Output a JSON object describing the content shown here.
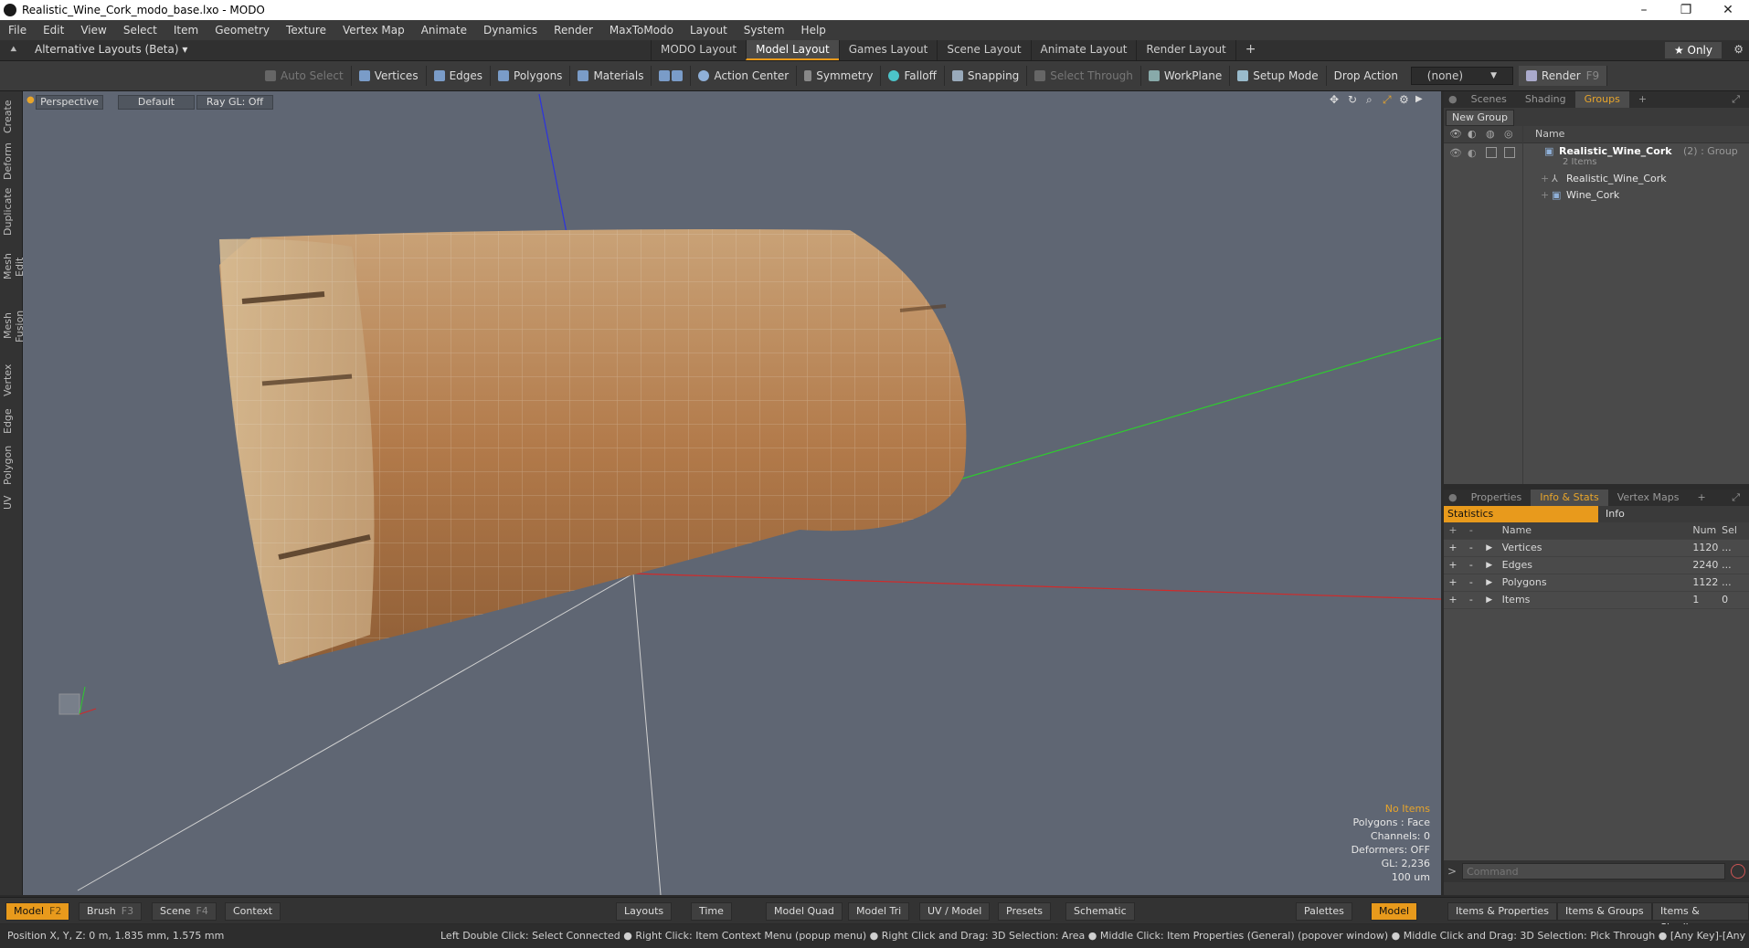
{
  "window": {
    "title": "Realistic_Wine_Cork_modo_base.lxo - MODO",
    "minimize": "–",
    "maximize": "❐",
    "close": "✕"
  },
  "menu": [
    "File",
    "Edit",
    "View",
    "Select",
    "Item",
    "Geometry",
    "Texture",
    "Vertex Map",
    "Animate",
    "Dynamics",
    "Render",
    "MaxToModo",
    "Layout",
    "System",
    "Help"
  ],
  "layoutbar": {
    "alt_layouts": "Alternative Layouts (Beta) ▾",
    "tabs": [
      "MODO Layout",
      "Model Layout",
      "Games Layout",
      "Scene Layout",
      "Animate Layout",
      "Render Layout"
    ],
    "add": "+",
    "only": "★ Only"
  },
  "toolbar": {
    "auto_select": "Auto Select",
    "vertices": "Vertices",
    "edges": "Edges",
    "polygons": "Polygons",
    "materials": "Materials",
    "action_center": "Action Center",
    "symmetry": "Symmetry",
    "falloff": "Falloff",
    "snapping": "Snapping",
    "select_through": "Select Through",
    "workplane": "WorkPlane",
    "setup_mode": "Setup Mode",
    "drop_action": "Drop Action",
    "drop_value": "(none)",
    "render": "Render",
    "render_key": "F9"
  },
  "lefttabs": [
    "Create",
    "Deform",
    "Duplicate",
    "Mesh Edit",
    "Mesh Fusion",
    "Vertex",
    "Edge",
    "Polygon",
    "UV"
  ],
  "viewport": {
    "view": "Perspective",
    "shading": "Default",
    "raygl": "Ray GL: Off",
    "stats": {
      "items": "No Items",
      "polygons": "Polygons : Face",
      "channels": "Channels: 0",
      "deformers": "Deformers: OFF",
      "gl": "GL: 2,236",
      "scale": "100 um"
    }
  },
  "scene_panel": {
    "tabs": [
      "Scenes",
      "Shading",
      "Groups"
    ],
    "new_group": "New Group",
    "col_name": "Name",
    "group_name": "Realistic_Wine_Cork",
    "group_suffix": "(2) : Group",
    "group_count": "2 Items",
    "children": [
      "Realistic_Wine_Cork",
      "Wine_Cork"
    ]
  },
  "stats_panel": {
    "tabs": [
      "Properties",
      "Info & Stats",
      "Vertex Maps"
    ],
    "subtabs": [
      "Statistics",
      "Info"
    ],
    "headers": [
      "Name",
      "Num",
      "Sel"
    ],
    "rows": [
      {
        "name": "Vertices",
        "num": "1120",
        "sel": "..."
      },
      {
        "name": "Edges",
        "num": "2240",
        "sel": "..."
      },
      {
        "name": "Polygons",
        "num": "1122",
        "sel": "..."
      },
      {
        "name": "Items",
        "num": "1",
        "sel": "0"
      }
    ],
    "command_placeholder": "Command"
  },
  "bottombar": {
    "model": "Model",
    "model_key": "F2",
    "brush": "Brush",
    "brush_key": "F3",
    "scene": "Scene",
    "scene_key": "F4",
    "context": "Context",
    "layouts": "Layouts",
    "time": "Time",
    "model_quad": "Model Quad",
    "model_tri": "Model Tri",
    "uv_model": "UV / Model",
    "presets": "Presets",
    "schematic": "Schematic",
    "palettes": "Palettes",
    "model2": "Model",
    "items_props": "Items & Properties",
    "items_groups": "Items & Groups",
    "items_shading": "Items & Shading"
  },
  "statusbar": {
    "position": "Position X, Y, Z:   0 m, 1.835 mm, 1.575 mm",
    "hints": "Left Double Click: Select Connected ● Right Click: Item Context Menu (popup menu) ● Right Click and Drag: 3D Selection: Area ● Middle Click: Item Properties (General) (popover window) ● Middle Click and Drag: 3D Selection: Pick Through ● [Any Key]-[Any Button] Click and Drag: dragDropB..."
  }
}
